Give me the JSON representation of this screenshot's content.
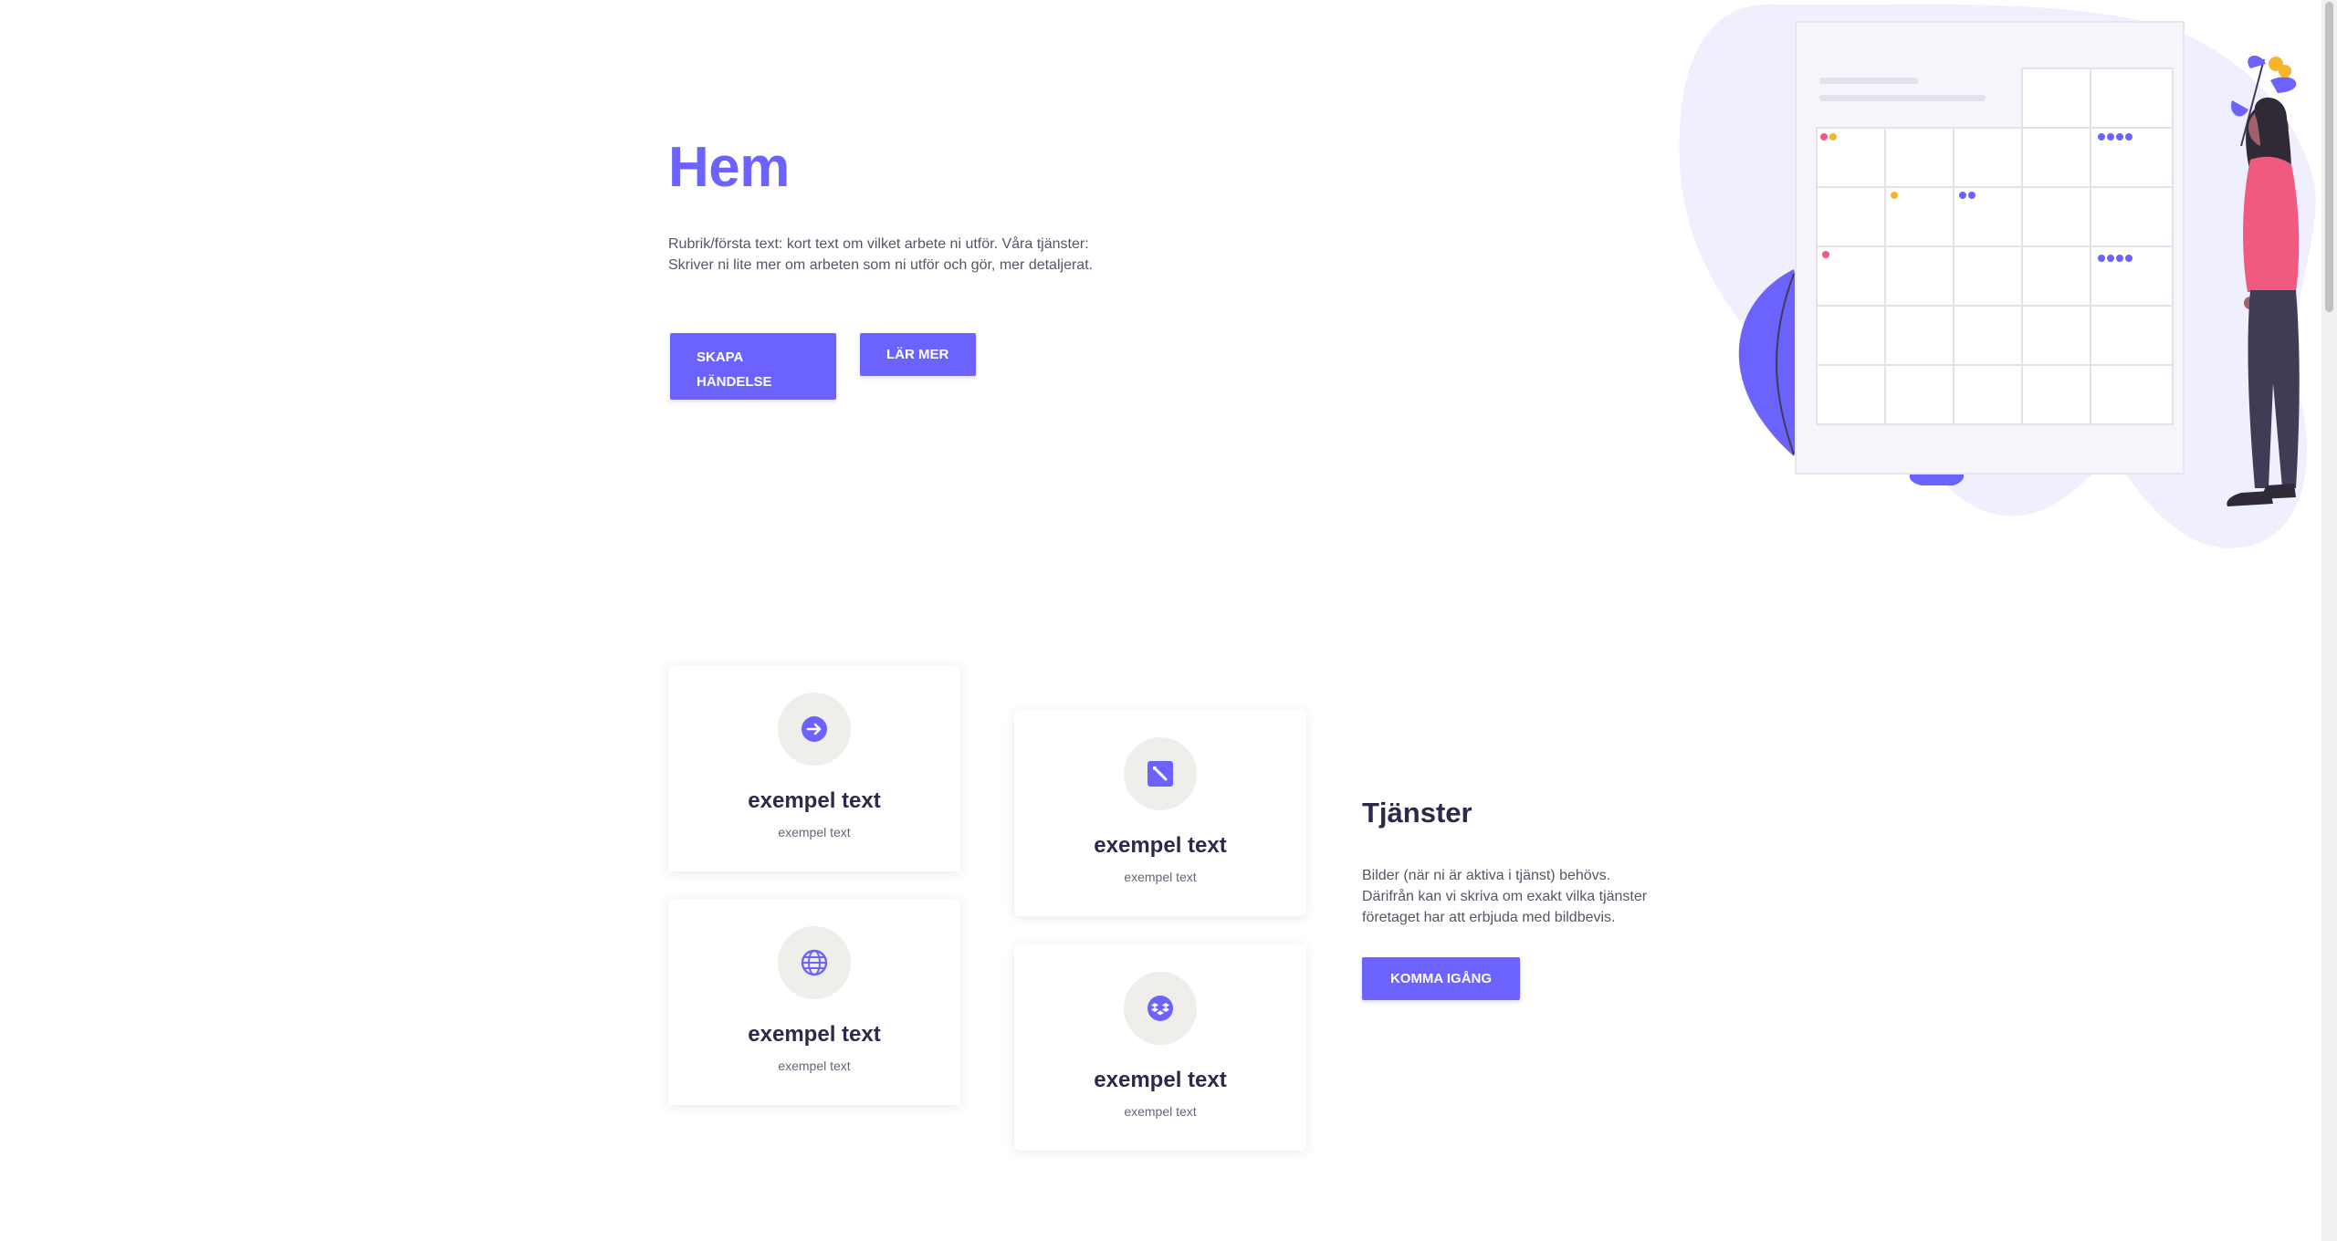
{
  "hero": {
    "title": "Hem",
    "text_line1": "Rubrik/första text: kort text om vilket arbete ni utför. Våra tjänster:",
    "text_line2": "Skriver ni lite mer om arbeten som ni utför och gör, mer detaljerat.",
    "create_button_line1": "SKAPA",
    "create_button_line2": "HÄNDELSE",
    "learn_button": "LÄR MER"
  },
  "cards": [
    {
      "title": "exempel text",
      "subtitle": "exempel text",
      "icon": "arrow-right-circle-icon"
    },
    {
      "title": "exempel text",
      "subtitle": "exempel text",
      "icon": "pencil-square-icon"
    },
    {
      "title": "exempel text",
      "subtitle": "exempel text",
      "icon": "globe-icon"
    },
    {
      "title": "exempel text",
      "subtitle": "exempel text",
      "icon": "dropbox-icon"
    }
  ],
  "services": {
    "title": "Tjänster",
    "text_line1": "Bilder (när ni är aktiva i tjänst) behövs.",
    "text_line2": "Därifrån kan vi skriva om exakt vilka tjänster",
    "text_line3": "företaget har att erbjuda med bildbevis.",
    "button": "KOMMA IGÅNG"
  },
  "colors": {
    "accent": "#6c63ff",
    "heading_dark": "#2b2a4c",
    "icon_bg": "#efeeea",
    "blob": "#f0effd"
  }
}
